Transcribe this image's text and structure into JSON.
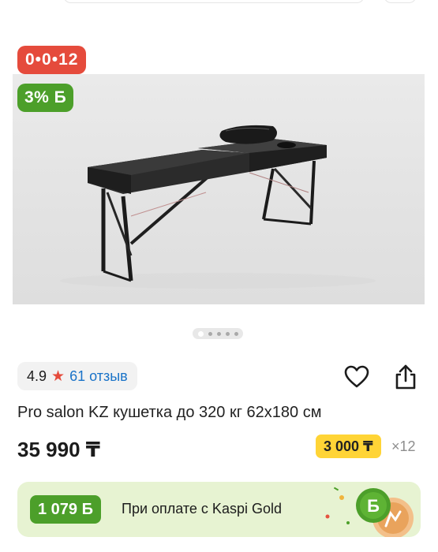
{
  "badges": {
    "timer": "0•0•12",
    "bonus": "3% Б"
  },
  "carousel": {
    "dot_count": 5,
    "active_index": 0
  },
  "rating": {
    "value": "4.9",
    "reviews": "61 отзыв"
  },
  "product": {
    "title": "Pro salon KZ кушетка до 320 кг 62х180 см",
    "price": "35 990 ₸"
  },
  "installment": {
    "amount": "3 000 ₸",
    "months": "×12"
  },
  "gold_banner": {
    "cashback": "1 079 Б",
    "text": "При оплате с Kaspi Gold",
    "logo_letter": "Б"
  },
  "colors": {
    "timer_red": "#e54b3c",
    "bonus_green": "#4c9f2a",
    "installment_yellow": "#ffd436",
    "link_blue": "#1a73c8",
    "banner_bg": "#e7f3d2"
  },
  "icons": {
    "rating": "star-icon",
    "favorite": "heart-icon",
    "share": "share-icon"
  }
}
